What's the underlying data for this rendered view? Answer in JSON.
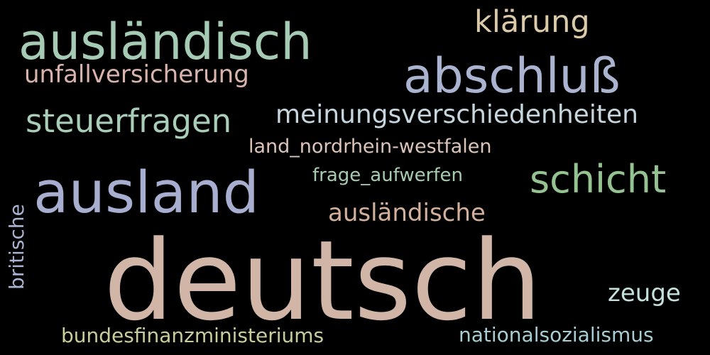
{
  "wordcloud": {
    "words": [
      {
        "text": "deutsch",
        "color": "#d1b6a8"
      },
      {
        "text": "ausländisch",
        "color": "#a6cbb5"
      },
      {
        "text": "abschluß",
        "color": "#aab3cf"
      },
      {
        "text": "ausland",
        "color": "#a8aed0"
      },
      {
        "text": "klärung",
        "color": "#dbcaa8"
      },
      {
        "text": "unfallversicherung",
        "color": "#d8b4ac"
      },
      {
        "text": "steuerfragen",
        "color": "#a8cdb8"
      },
      {
        "text": "meinungsverschiedenheiten",
        "color": "#c6d6df"
      },
      {
        "text": "land_nordrhein-westfalen",
        "color": "#dcc4b9"
      },
      {
        "text": "frage_aufwerfen",
        "color": "#a6cbaf"
      },
      {
        "text": "schicht",
        "color": "#94c290"
      },
      {
        "text": "ausländische",
        "color": "#d2b09b"
      },
      {
        "text": "zeuge",
        "color": "#c3e0dc"
      },
      {
        "text": "bundesfinanzministeriums",
        "color": "#c7cd9b"
      },
      {
        "text": "nationalsozialismus",
        "color": "#a8cdd3"
      },
      {
        "text": "britische",
        "color": "#aab3cf"
      }
    ],
    "background": "#000000"
  }
}
